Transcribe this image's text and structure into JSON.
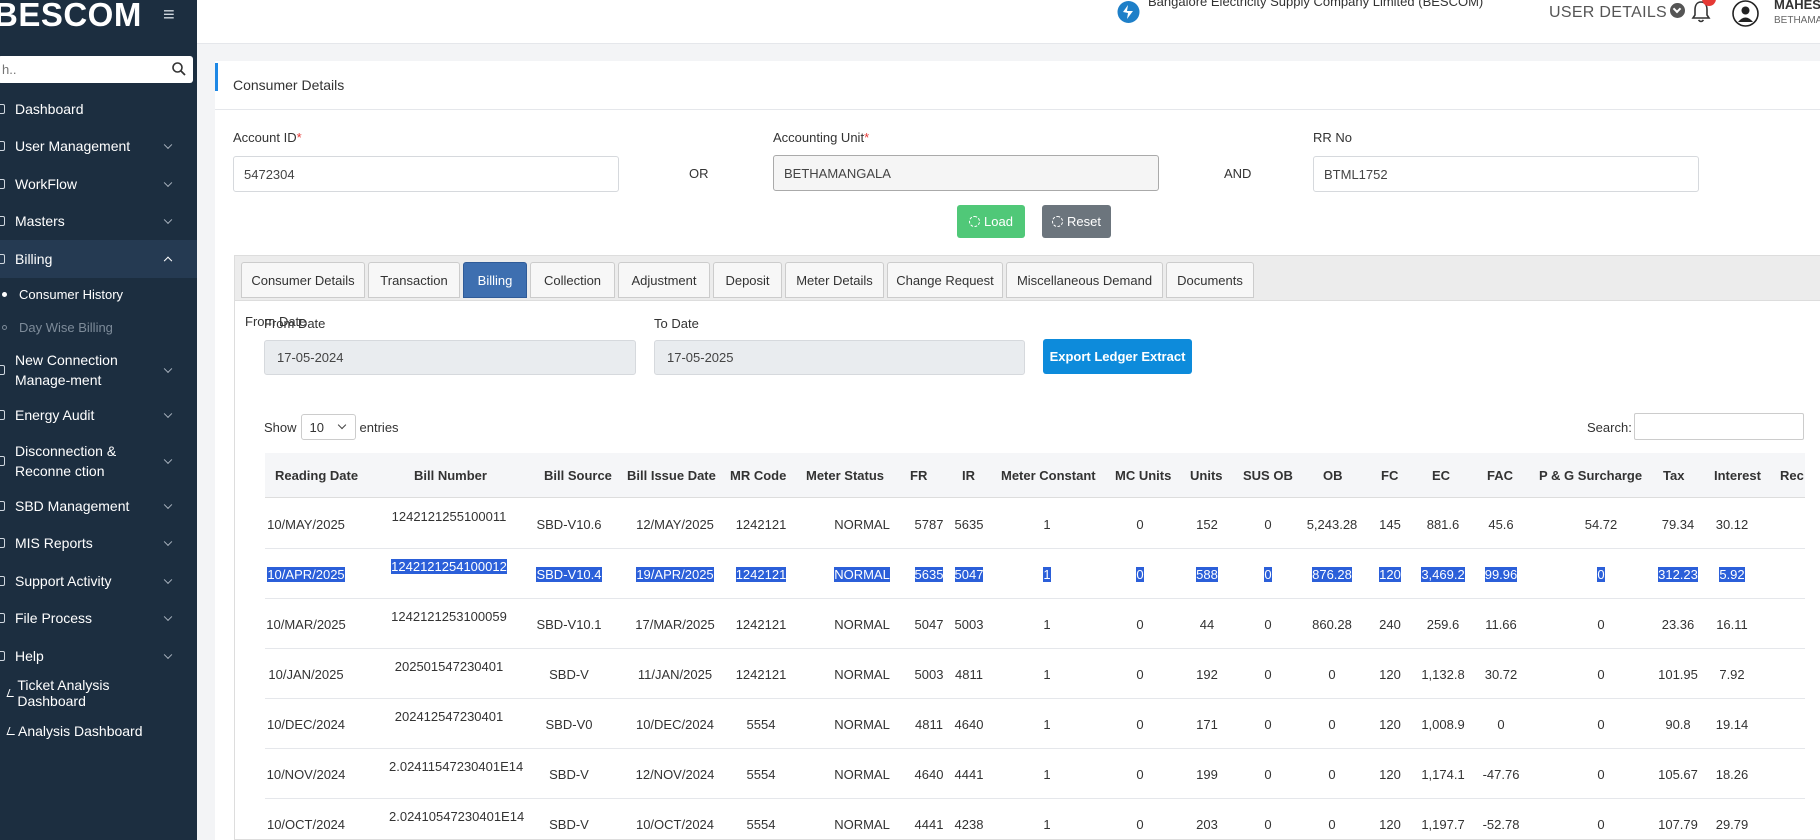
{
  "sidebar": {
    "brand": "BESCOM",
    "search_placeholder": "h..",
    "items": [
      {
        "label": "Dashboard"
      },
      {
        "label": "User Management"
      },
      {
        "label": "WorkFlow"
      },
      {
        "label": "Masters"
      },
      {
        "label": "Billing"
      },
      {
        "label": "New Connection Manage-ment"
      },
      {
        "label": "Energy Audit"
      },
      {
        "label": "Disconnection & Reconne ction"
      },
      {
        "label": "SBD Management"
      },
      {
        "label": "MIS Reports"
      },
      {
        "label": "Support Activity"
      },
      {
        "label": "File Process"
      },
      {
        "label": "Help"
      },
      {
        "label": "Ticket Analysis Dashboard"
      },
      {
        "label": "Analysis Dashboard"
      }
    ],
    "billing_sub": [
      {
        "label": "Consumer History"
      },
      {
        "label": "Day Wise Billing"
      }
    ]
  },
  "header": {
    "company": "Bangalore Electricity Supply Company Limited (BESCOM)",
    "user_details": "USER DETAILS",
    "user_name": "MAHES",
    "user_unit": "BETHAMA"
  },
  "page": {
    "title": "Consumer Details",
    "account_id_label": "Account ID",
    "account_id_value": "5472304",
    "or_label": "OR",
    "accounting_unit_label": "Accounting Unit",
    "accounting_unit_value": "BETHAMANGALA",
    "and_label": "AND",
    "rr_label": "RR No",
    "rr_value": "BTML1752",
    "load_label": "Load",
    "reset_label": "Reset",
    "required_mark": "*"
  },
  "tabs": [
    {
      "label": "Consumer Details"
    },
    {
      "label": "Transaction"
    },
    {
      "label": "Billing"
    },
    {
      "label": "Collection"
    },
    {
      "label": "Adjustment"
    },
    {
      "label": "Deposit"
    },
    {
      "label": "Meter Details"
    },
    {
      "label": "Change Request"
    },
    {
      "label": "Miscellaneous Demand"
    },
    {
      "label": "Documents"
    }
  ],
  "billing": {
    "from_label": "From Date",
    "from_value": "17-05-2024",
    "to_label": "To Date",
    "to_value": "17-05-2025",
    "export_label": "Export Ledger Extract",
    "show_label": "Show",
    "entries_value": "10",
    "entries_label": "entries",
    "search_label": "Search:"
  },
  "table": {
    "headers": [
      "Reading Date",
      "Bill Number",
      "Bill Source",
      "Bill Issue Date",
      "MR Code",
      "Meter Status",
      "FR",
      "IR",
      "Meter Constant",
      "MC Units",
      "Units",
      "SUS OB",
      "OB",
      "FC",
      "EC",
      "FAC",
      "P & G Surcharge",
      "Tax",
      "Interest",
      "Rec"
    ],
    "rows": [
      [
        "10/MAY/2025",
        "1242121255100011",
        "SBD-V10.6",
        "12/MAY/2025",
        "1242121",
        "NORMAL",
        "5787",
        "5635",
        "1",
        "0",
        "152",
        "0",
        "5,243.28",
        "145",
        "881.6",
        "45.6",
        "54.72",
        "79.34",
        "30.12"
      ],
      [
        "10/APR/2025",
        "1242121254100012",
        "SBD-V10.4",
        "19/APR/2025",
        "1242121",
        "NORMAL",
        "5635",
        "5047",
        "1",
        "0",
        "588",
        "0",
        "876.28",
        "120",
        "3,469.2",
        "99.96",
        "0",
        "312.23",
        "5.92"
      ],
      [
        "10/MAR/2025",
        "1242121253100059",
        "SBD-V10.1",
        "17/MAR/2025",
        "1242121",
        "NORMAL",
        "5047",
        "5003",
        "1",
        "0",
        "44",
        "0",
        "860.28",
        "240",
        "259.6",
        "11.66",
        "0",
        "23.36",
        "16.11"
      ],
      [
        "10/JAN/2025",
        "202501547230401",
        "SBD-V",
        "11/JAN/2025",
        "1242121",
        "NORMAL",
        "5003",
        "4811",
        "1",
        "0",
        "192",
        "0",
        "0",
        "120",
        "1,132.8",
        "30.72",
        "0",
        "101.95",
        "7.92"
      ],
      [
        "10/DEC/2024",
        "202412547230401",
        "SBD-V0",
        "10/DEC/2024",
        "5554",
        "NORMAL",
        "4811",
        "4640",
        "1",
        "0",
        "171",
        "0",
        "0",
        "120",
        "1,008.9",
        "0",
        "0",
        "90.8",
        "19.14"
      ],
      [
        "10/NOV/2024",
        "2.02411547230401E14",
        "SBD-V",
        "12/NOV/2024",
        "5554",
        "NORMAL",
        "4640",
        "4441",
        "1",
        "0",
        "199",
        "0",
        "0",
        "120",
        "1,174.1",
        "-47.76",
        "0",
        "105.67",
        "18.26"
      ],
      [
        "10/OCT/2024",
        "2.02410547230401E14",
        "SBD-V",
        "10/OCT/2024",
        "5554",
        "NORMAL",
        "4441",
        "4238",
        "1",
        "0",
        "203",
        "0",
        "0",
        "120",
        "1,197.7",
        "-52.78",
        "0",
        "107.79",
        "29.79"
      ]
    ]
  }
}
